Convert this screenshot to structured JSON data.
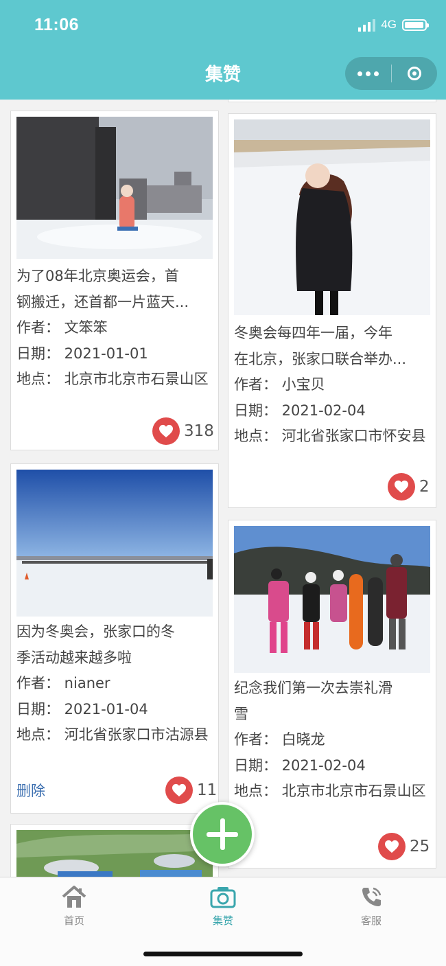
{
  "status_bar": {
    "time": "11:06",
    "network": "4G"
  },
  "nav": {
    "title": "集赞"
  },
  "cards": [
    {
      "title_lines": [
        "为了08年北京奥运会，首",
        "钢搬迁，还首都一片蓝天..."
      ],
      "author": "作者：  文笨笨",
      "date": "日期：  2021-01-01",
      "location": "地点：  北京市北京市石景山区",
      "likes": "318"
    },
    {
      "title_lines": [
        "冬奥会每四年一届，今年",
        "在北京，张家口联合举办..."
      ],
      "author": "作者：  小宝贝",
      "date": "日期：  2021-02-04",
      "location": "地点：  河北省张家口市怀安县",
      "likes": "2"
    },
    {
      "title_lines": [
        "因为冬奥会，张家口的冬",
        "季活动越来越多啦"
      ],
      "author": "作者：  nianer",
      "date": "日期：  2021-01-04",
      "location": "地点：  河北省张家口市沽源县",
      "likes": "11",
      "delete_label": "删除"
    },
    {
      "title_lines": [
        "纪念我们第一次去崇礼滑",
        "雪"
      ],
      "author": "作者：  白晓龙",
      "date": "日期：  2021-02-04",
      "location": "地点：  北京市北京市石景山区",
      "likes": "25"
    }
  ],
  "tabbar": {
    "items": [
      {
        "label": "首页",
        "icon": "home-icon",
        "color": "#888888"
      },
      {
        "label": "集赞",
        "icon": "camera-icon",
        "color": "#3aa6ad"
      },
      {
        "label": "客服",
        "icon": "phone-icon",
        "color": "#888888"
      }
    ]
  },
  "colors": {
    "header": "#5ec8cf",
    "like": "#e04b4b",
    "fab": "#66c266",
    "link": "#3c6fb0"
  }
}
